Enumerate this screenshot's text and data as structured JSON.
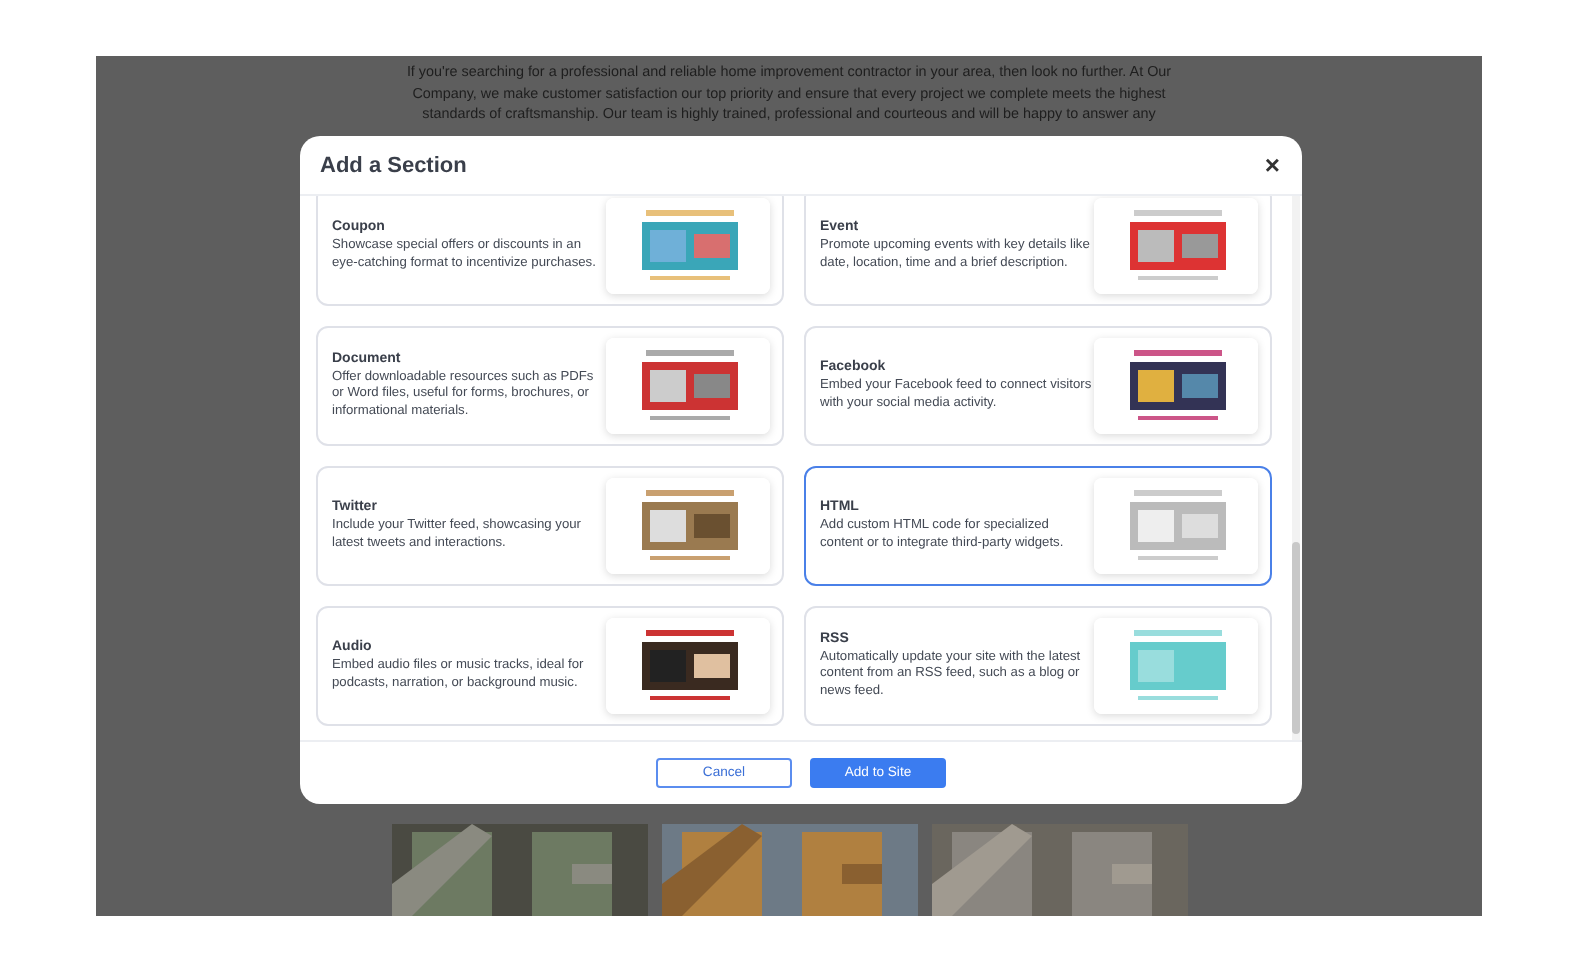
{
  "background_page": {
    "paragraph": "If you're searching for a professional and reliable home improvement contractor in your area, then look no further. At Our Company, we make customer satisfaction our top priority and ensure that every project we complete meets the highest standards of craftsmanship. Our team is highly trained, professional and courteous and will be happy to answer any"
  },
  "dialog": {
    "title": "Add a Section",
    "close": "×",
    "sections": [
      {
        "name": "Coupon",
        "description": "Showcase special offers or discounts in an eye-catching format to incentivize purchases.",
        "selected": false
      },
      {
        "name": "Event",
        "description": "Promote upcoming events with key details like date, location, time and a brief description.",
        "selected": false
      },
      {
        "name": "Document",
        "description": "Offer downloadable resources such as PDFs or Word files, useful for forms, brochures, or informational materials.",
        "selected": false
      },
      {
        "name": "Facebook",
        "description": "Embed your Facebook feed to connect visitors with your social media activity.",
        "selected": false
      },
      {
        "name": "Twitter",
        "description": "Include your Twitter feed, showcasing your latest tweets and interactions.",
        "selected": false
      },
      {
        "name": "HTML",
        "description": "Add custom HTML code for specialized content or to integrate third-party widgets.",
        "selected": true
      },
      {
        "name": "Audio",
        "description": "Embed audio files or music tracks, ideal for podcasts, narration, or background music.",
        "selected": false
      },
      {
        "name": "RSS",
        "description": "Automatically update your site with the latest content from an RSS feed, such as a blog or news feed.",
        "selected": false
      }
    ],
    "buttons": [
      {
        "label": "Cancel",
        "kind": "secondary"
      },
      {
        "label": "Add to Site",
        "kind": "primary"
      }
    ]
  }
}
